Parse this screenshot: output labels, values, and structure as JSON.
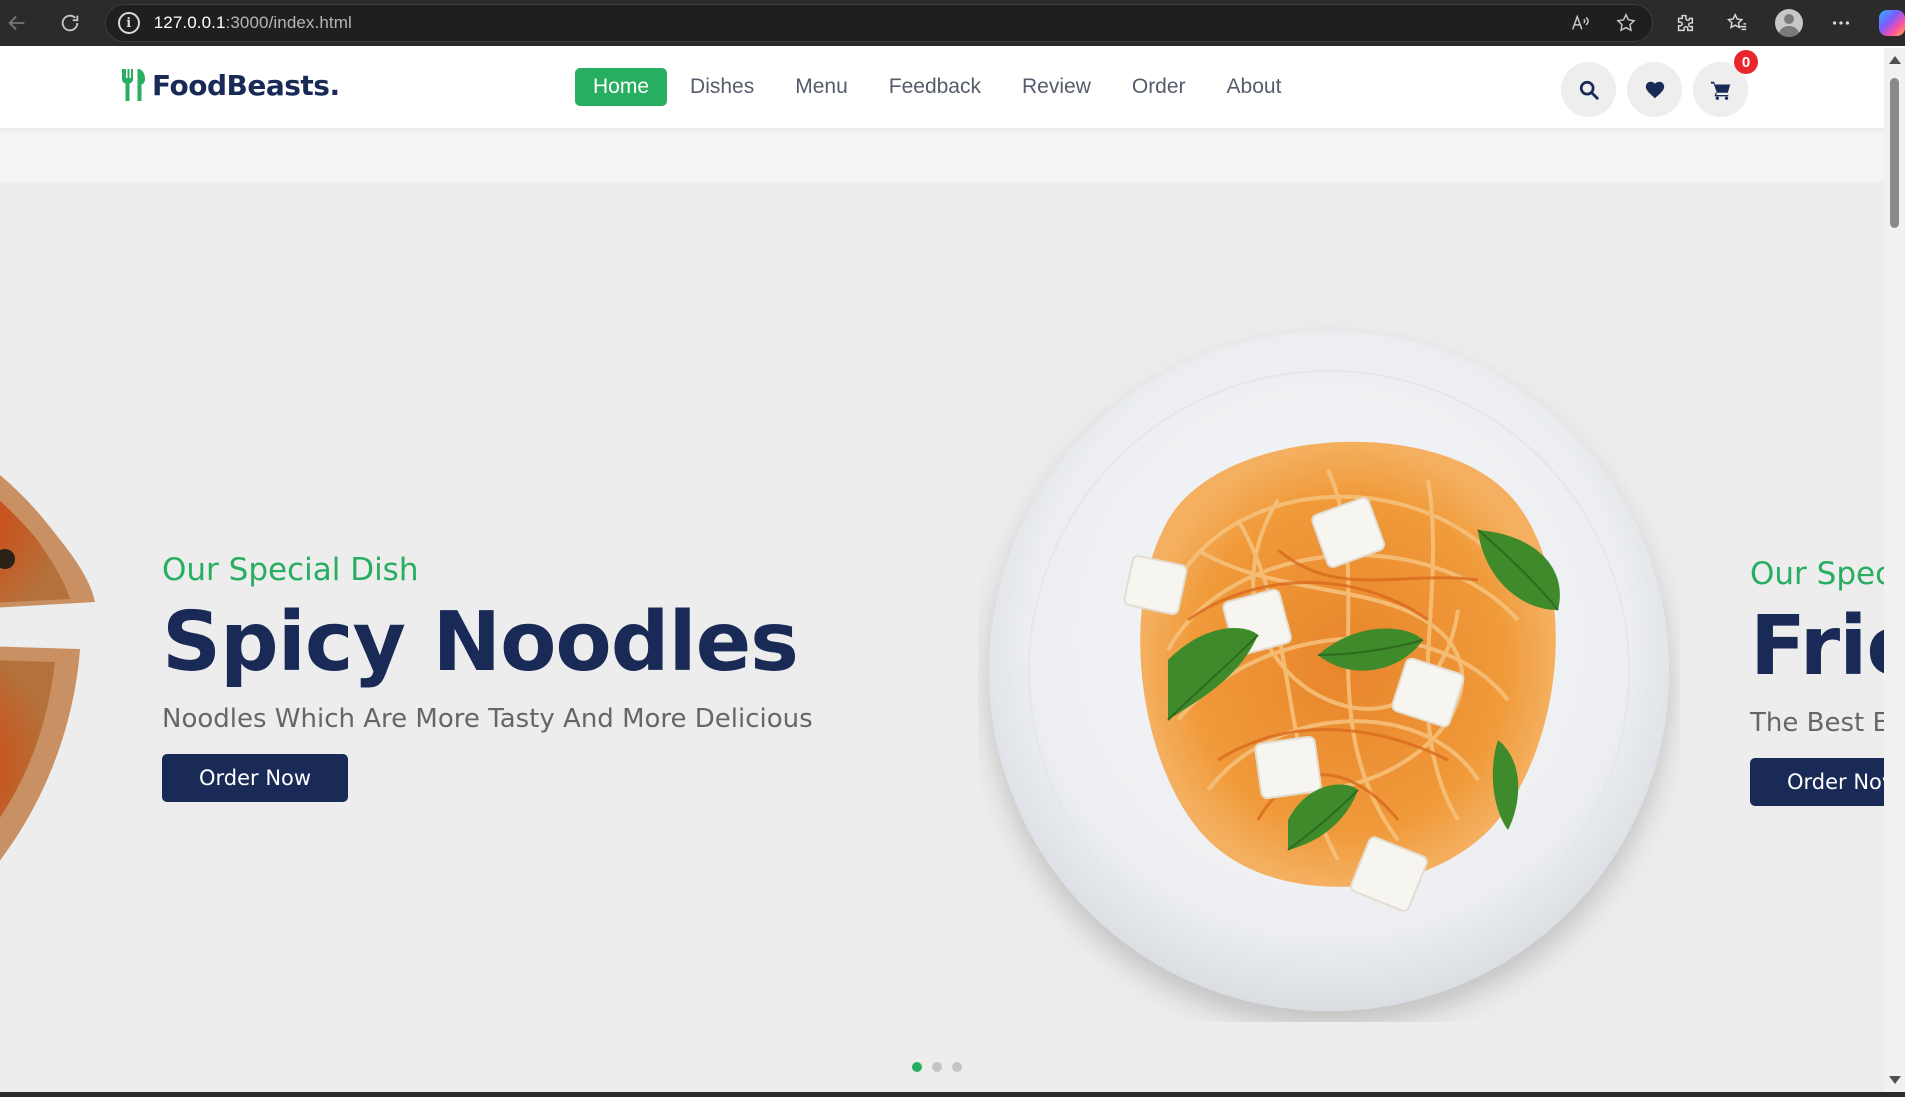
{
  "browser": {
    "url_host": "127.0.0.1",
    "url_path": ":3000/index.html",
    "icons": [
      "back-arrow-icon",
      "refresh-icon",
      "site-info-icon",
      "read-aloud-icon",
      "favorite-star-icon",
      "extensions-icon",
      "favorites-icon",
      "profile-avatar",
      "more-options-icon",
      "copilot-icon"
    ]
  },
  "header": {
    "logo_text": "FoodBeasts.",
    "nav": [
      {
        "label": "Home",
        "active": true
      },
      {
        "label": "Dishes"
      },
      {
        "label": "Menu"
      },
      {
        "label": "Feedback"
      },
      {
        "label": "Review"
      },
      {
        "label": "Order"
      },
      {
        "label": "About"
      }
    ],
    "cart_count": "0",
    "icons": [
      "search-icon",
      "heart-icon",
      "cart-icon"
    ]
  },
  "slider": {
    "current": {
      "subtitle": "Our Special Dish",
      "title": "Spicy Noodles",
      "description": "Noodles Which Are More Tasty And More Delicious",
      "button": "Order Now"
    },
    "next": {
      "subtitle": "Our Spec",
      "title": "Frie",
      "description": "The Best E",
      "button": "Order Nov"
    },
    "dots": 3,
    "active_dot": 1
  },
  "colors": {
    "accent_green": "#27ae60",
    "navy": "#192a56",
    "badge_red": "#e8262b"
  }
}
